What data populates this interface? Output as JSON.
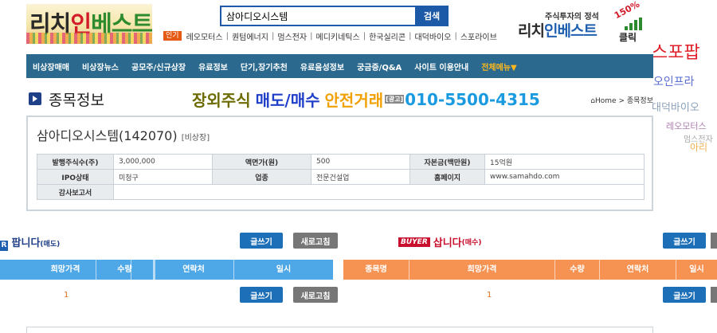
{
  "logo": {
    "part1": "리치",
    "part2": "인",
    "part3": "베스트"
  },
  "search": {
    "value": "삼아디오시스템",
    "button": "검색"
  },
  "popular": {
    "badge": "인기",
    "keywords": [
      "레오모터스",
      "퀀텀에너지",
      "멈스전자",
      "메디키네틱스",
      "한국실리콘",
      "대덕바이오",
      "스포라이브"
    ]
  },
  "ad_right": {
    "tagline": "주식투자의 정석",
    "brand1": "리치",
    "brand2": "인베스트",
    "percent": "150%",
    "click": "클릭"
  },
  "nav": [
    "비상장매매",
    "비상장뉴스",
    "공모주/신규상장",
    "유료정보",
    "단기,장기추천",
    "유료음성정보",
    "궁금증/Q&A",
    "사이트 이용안내",
    "전체메뉴▼"
  ],
  "title": {
    "page": "종목정보",
    "promo1": "장외주식",
    "promo2": "매도/매수",
    "promo3": "안전거래",
    "promo4": "[광고]",
    "promo5": "010-5500-4315",
    "breadcrumb_home": "Home",
    "breadcrumb_sep": ">",
    "breadcrumb_current": "종목정보"
  },
  "stock": {
    "name": "삼아디오시스템(142070)",
    "category": "[비상장]",
    "rows": [
      [
        {
          "label": "발행주식수(주)",
          "value": "3,000,000"
        },
        {
          "label": "액면가(원)",
          "value": "500"
        },
        {
          "label": "자본금(백만원)",
          "value": "15억원"
        }
      ],
      [
        {
          "label": "IPO상태",
          "value": "미청구"
        },
        {
          "label": "업종",
          "value": "전문건설업"
        },
        {
          "label": "홈페이지",
          "value": "www.samahdo.com"
        }
      ],
      [
        {
          "label": "감사보고서",
          "value": ""
        }
      ]
    ]
  },
  "sell": {
    "icon": "R",
    "title": "팝니다",
    "sub": "(매도)",
    "write": "글쓰기",
    "refresh": "새로고침",
    "columns": [
      "희망가격",
      "수량",
      "연락처",
      "일시"
    ],
    "page": "1"
  },
  "buy": {
    "tag": "BUYER",
    "title": "삽니다",
    "sub": "(매수)",
    "write": "글쓰기",
    "columns": [
      "종목명",
      "희망가격",
      "수량",
      "연락처",
      "일시"
    ],
    "page": "1"
  },
  "cloud": [
    "스포팝",
    "오인프라",
    "대덕바이오",
    "레오모터스",
    "멈스전자",
    "아리"
  ],
  "colors": {
    "nav": "#2b6a8e",
    "sell_header": "#4ea7e6",
    "buy_header": "#f69353",
    "button_blue": "#1d6fb8",
    "button_gray": "#777777"
  }
}
